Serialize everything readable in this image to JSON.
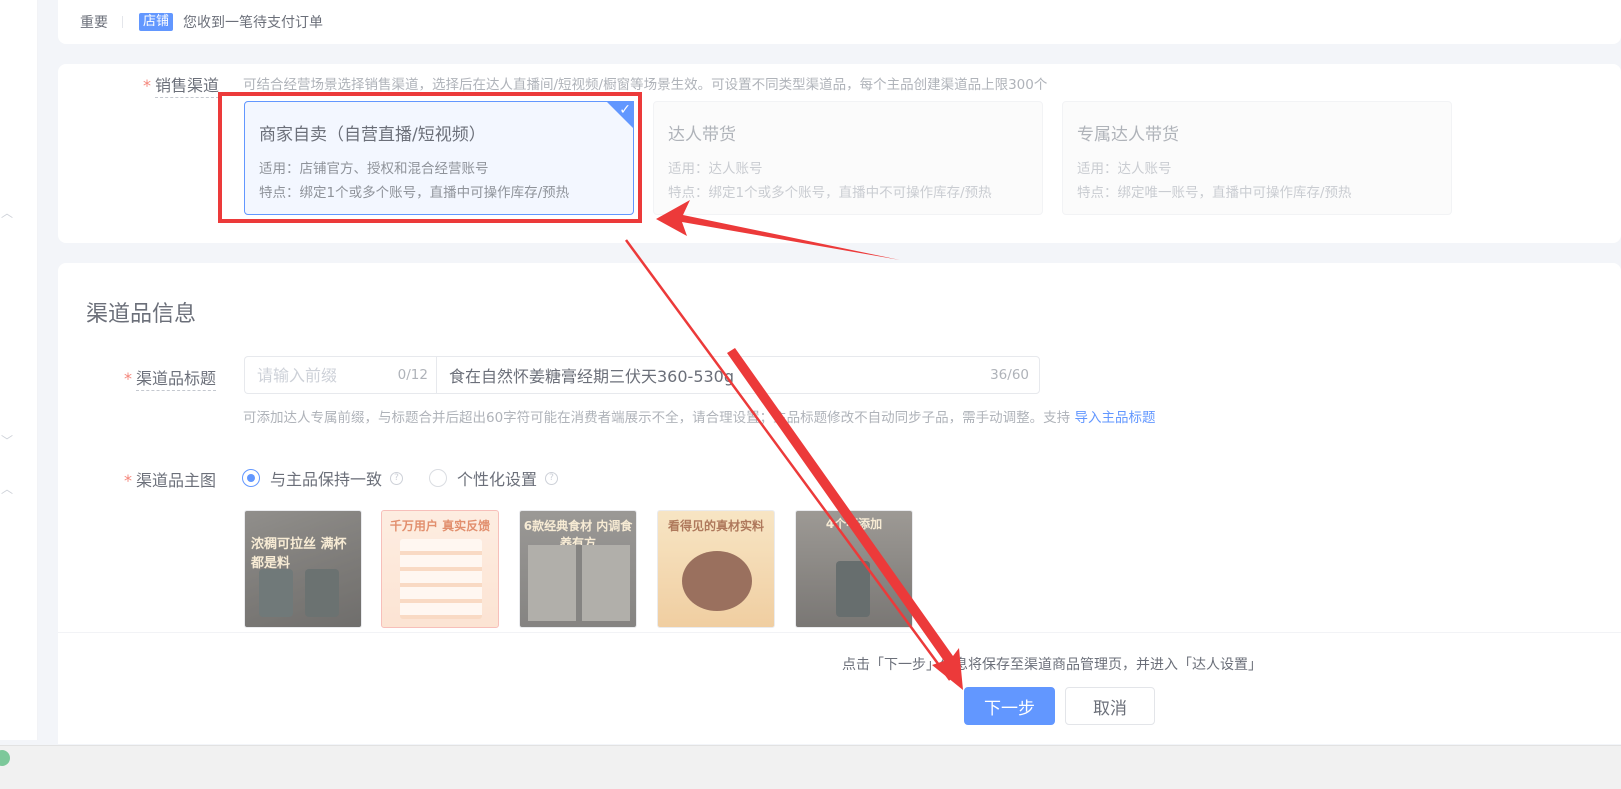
{
  "notice": {
    "important": "重要",
    "tag": "店铺",
    "message": "您收到一笔待支付订单"
  },
  "sales_channel": {
    "label": "销售渠道",
    "hint": "可结合经营场景选择销售渠道，选择后在达人直播间/短视频/橱窗等场景生效。可设置不同类型渠道品，每个主品创建渠道品上限300个",
    "options": [
      {
        "title": "商家自卖（自营直播/短视频）",
        "line1": "适用：店铺官方、授权和混合经营账号",
        "line2": "特点：绑定1个或多个账号，直播中可操作库存/预热",
        "selected": true
      },
      {
        "title": "达人带货",
        "line1": "适用：达人账号",
        "line2": "特点：绑定1个或多个账号，直播中不可操作库存/预热",
        "selected": false
      },
      {
        "title": "专属达人带货",
        "line1": "适用：达人账号",
        "line2": "特点：绑定唯一账号，直播中可操作库存/预热",
        "selected": false
      }
    ]
  },
  "channel_info": {
    "section_title": "渠道品信息",
    "title_label": "渠道品标题",
    "prefix_placeholder": "请输入前缀",
    "prefix_count": "0/12",
    "title_value": "食在自然怀姜糖膏经期三伏天360-530g",
    "title_count": "36/60",
    "title_hint": "可添加达人专属前缀，与标题合并后超出60字符可能在消费者端展示不全，请合理设置；主品标题修改不自动同步子品，需手动调整。支持",
    "title_hint_link": "导入主品标题",
    "image_label": "渠道品主图",
    "radio_same": "与主品保持一致",
    "radio_custom": "个性化设置",
    "thumbnails": [
      {
        "caption": "浓稠可拉丝 满杯都是料"
      },
      {
        "caption": "千万用户 真实反馈"
      },
      {
        "caption": "6款经典食材 内调食养有方"
      },
      {
        "caption": "看得见的真材实料"
      },
      {
        "caption": "4个不添加"
      }
    ]
  },
  "footer": {
    "hint": "点击「下一步」信息将保存至渠道商品管理页，并进入「达人设置」",
    "next_label": "下一步",
    "cancel_label": "取消"
  },
  "colors": {
    "primary": "#1966ff",
    "annotation_red": "#ec3a3a",
    "required": "#f04b3b"
  }
}
